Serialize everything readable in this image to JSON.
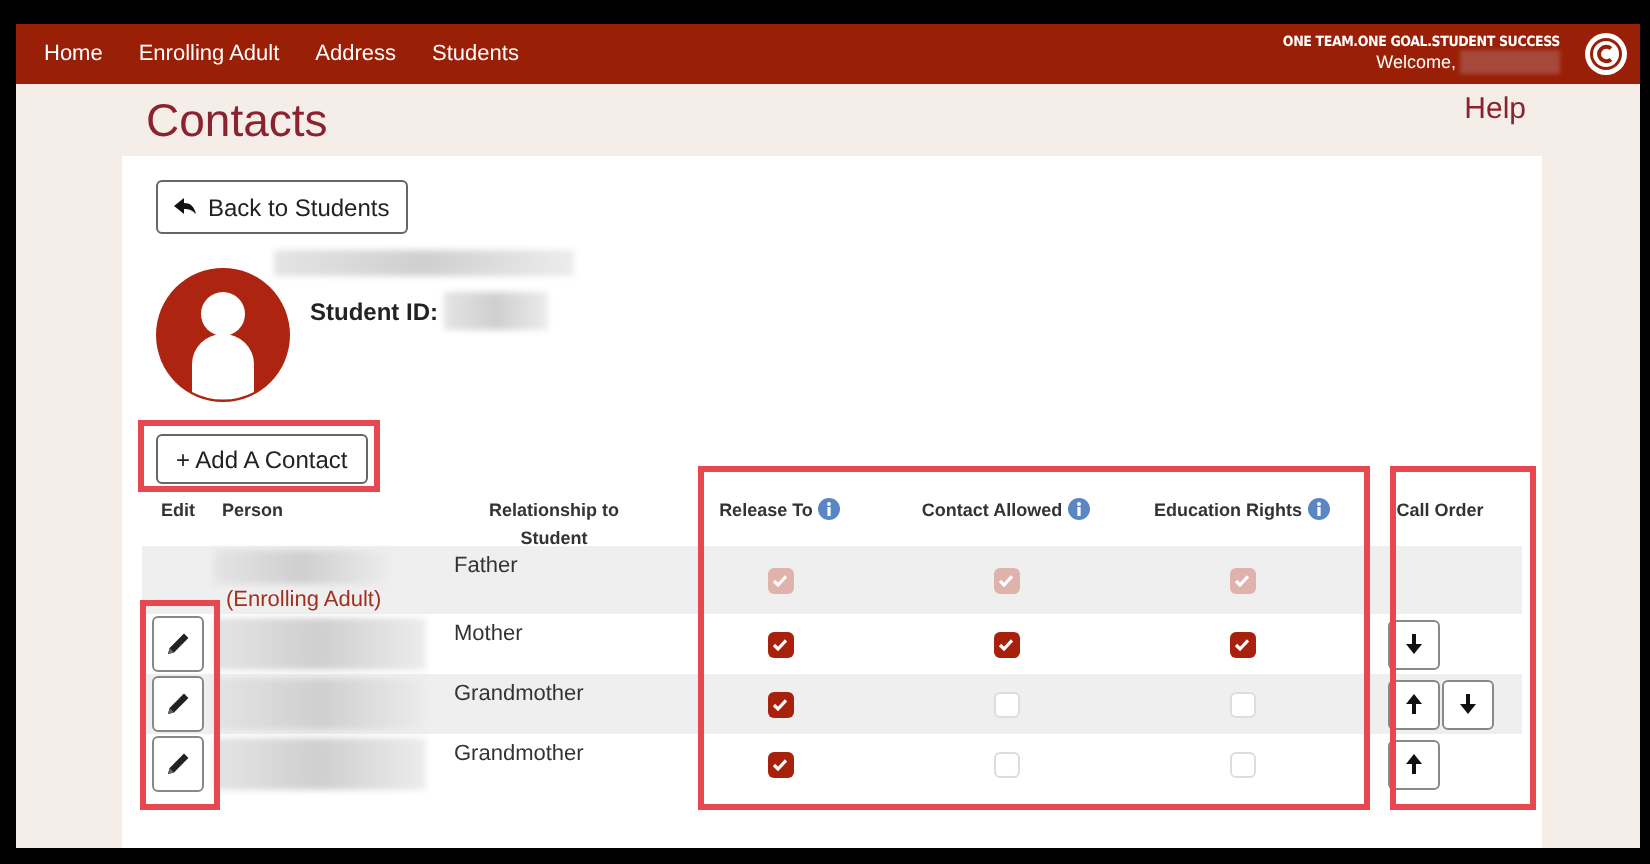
{
  "nav": {
    "items": [
      "Home",
      "Enrolling Adult",
      "Address",
      "Students"
    ],
    "tagline": "ONE TEAM.ONE GOAL.STUDENT SUCCESS",
    "welcome": "Welcome,"
  },
  "page": {
    "title": "Contacts",
    "help": "Help"
  },
  "back_button": "Back to Students",
  "student": {
    "id_label": "Student ID:"
  },
  "add_button": "+ Add A Contact",
  "table": {
    "columns": [
      {
        "label": "Edit",
        "info": false
      },
      {
        "label": "Person",
        "info": false
      },
      {
        "label": "Relationship to Student",
        "info": false
      },
      {
        "label": "Release To",
        "info": true
      },
      {
        "label": "Contact Allowed",
        "info": true
      },
      {
        "label": "Education Rights",
        "info": true
      },
      {
        "label": "Call Order",
        "info": false
      }
    ],
    "rows": [
      {
        "editable": false,
        "note": "(Enrolling Adult)",
        "relationship": "Father",
        "release_to": {
          "checked": true,
          "disabled": true
        },
        "contact_allowed": {
          "checked": true,
          "disabled": true
        },
        "education_rights": {
          "checked": true,
          "disabled": true
        },
        "call_order": []
      },
      {
        "editable": true,
        "relationship": "Mother",
        "release_to": {
          "checked": true,
          "disabled": false
        },
        "contact_allowed": {
          "checked": true,
          "disabled": false
        },
        "education_rights": {
          "checked": true,
          "disabled": false
        },
        "call_order": [
          {
            "kind": "down"
          }
        ]
      },
      {
        "editable": true,
        "relationship": "Grandmother",
        "release_to": {
          "checked": true,
          "disabled": false
        },
        "contact_allowed": {
          "checked": false,
          "disabled": false
        },
        "education_rights": {
          "checked": false,
          "disabled": false
        },
        "call_order": [
          {
            "kind": "up"
          },
          {
            "kind": "down"
          }
        ]
      },
      {
        "editable": true,
        "relationship": "Grandmother",
        "release_to": {
          "checked": true,
          "disabled": false
        },
        "contact_allowed": {
          "checked": false,
          "disabled": false
        },
        "education_rights": {
          "checked": false,
          "disabled": false
        },
        "call_order": [
          {
            "kind": "up"
          }
        ]
      }
    ]
  }
}
